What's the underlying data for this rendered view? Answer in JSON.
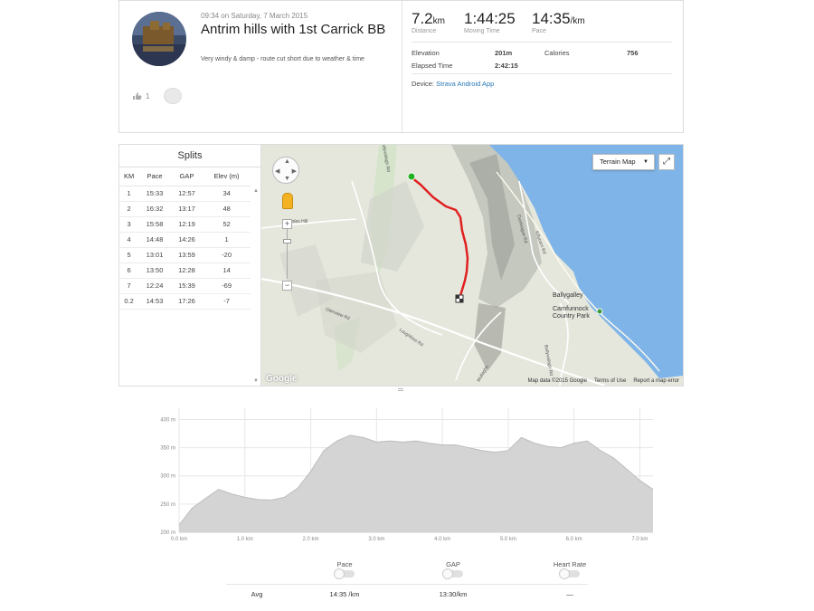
{
  "activity": {
    "date": "09:34 on Saturday, 7 March 2015",
    "title": "Antrim hills with 1st Carrick BB",
    "description": "Very windy & damp - route cut short due to weather & time",
    "kudos_count": "1",
    "stats": {
      "distance": {
        "value": "7.2",
        "unit": "km",
        "label": "Distance"
      },
      "moving_time": {
        "value": "1:44:25",
        "label": "Moving Time"
      },
      "pace": {
        "value": "14:35",
        "unit": "/km",
        "label": "Pace"
      }
    },
    "details": {
      "elevation_label": "Elevation",
      "elevation_value": "201m",
      "calories_label": "Calories",
      "calories_value": "756",
      "elapsed_label": "Elapsed Time",
      "elapsed_value": "2:42:15"
    },
    "device_label": "Device:",
    "device_value": "Strava Android App"
  },
  "splits": {
    "title": "Splits",
    "columns": [
      "KM",
      "Pace",
      "GAP",
      "Elev (m)"
    ],
    "rows": [
      [
        "1",
        "15:33",
        "12:57",
        "34"
      ],
      [
        "2",
        "16:32",
        "13:17",
        "48"
      ],
      [
        "3",
        "15:58",
        "12:19",
        "52"
      ],
      [
        "4",
        "14:48",
        "14:26",
        "1"
      ],
      [
        "5",
        "13:01",
        "13:59",
        "-20"
      ],
      [
        "6",
        "13:50",
        "12:28",
        "14"
      ],
      [
        "7",
        "12:24",
        "15:39",
        "-69"
      ],
      [
        "0.2",
        "14:53",
        "17:26",
        "-7"
      ]
    ]
  },
  "map": {
    "terrain_button": "Terrain Map",
    "google": "Google",
    "footer": [
      "Map data ©2015 Google",
      "Terms of Use",
      "Report a map error"
    ],
    "places": {
      "town": "Ballygalley",
      "park_line1": "Carnfunnock",
      "park_line2": "Country Park"
    },
    "roads": {
      "r1": "Glenview Rd",
      "r2": "Loughfoss Rd",
      "r3": "Ballyvallagh Rd",
      "r4": "Lisles Hill",
      "r5": "Dunteague Rd",
      "r6": "Killycarn Rd",
      "r7": "Ballyvallagh Rd",
      "r8": "Mullaghs"
    }
  },
  "chart_data": {
    "type": "area",
    "title": "",
    "xlabel": "",
    "ylabel": "",
    "x_unit": "km",
    "y_unit": "m",
    "xlim": [
      0,
      7.2
    ],
    "ylim": [
      200,
      420
    ],
    "x_ticks": [
      "0.0 km",
      "1.0 km",
      "2.0 km",
      "3.0 km",
      "4.0 km",
      "5.0 km",
      "6.0 km",
      "7.0 km"
    ],
    "y_ticks": [
      "200 m",
      "250 m",
      "300 m",
      "350 m",
      "400 m"
    ],
    "x": [
      0,
      0.1,
      0.2,
      0.4,
      0.6,
      0.8,
      1.0,
      1.2,
      1.4,
      1.6,
      1.8,
      2.0,
      2.2,
      2.4,
      2.6,
      2.8,
      3.0,
      3.2,
      3.4,
      3.6,
      3.8,
      4.0,
      4.2,
      4.4,
      4.6,
      4.8,
      5.0,
      5.2,
      5.4,
      5.6,
      5.8,
      6.0,
      6.2,
      6.4,
      6.6,
      6.8,
      7.0,
      7.2
    ],
    "values": [
      213,
      228,
      243,
      260,
      276,
      268,
      262,
      258,
      257,
      262,
      278,
      308,
      345,
      362,
      372,
      368,
      360,
      362,
      360,
      362,
      358,
      355,
      355,
      350,
      345,
      342,
      345,
      368,
      358,
      352,
      350,
      358,
      362,
      345,
      332,
      312,
      292,
      276
    ],
    "grid": true
  },
  "averages": {
    "headers": [
      "Pace",
      "GAP",
      "Heart Rate"
    ],
    "row_label": "Avg",
    "values": [
      "14:35 /km",
      "13:30/km",
      "—"
    ]
  },
  "colors": {
    "route": "#e02020",
    "start": "#1fb11f",
    "sea": "#7fb4e8",
    "area_fill": "#d4d4d4",
    "link": "#2a7ab8"
  }
}
